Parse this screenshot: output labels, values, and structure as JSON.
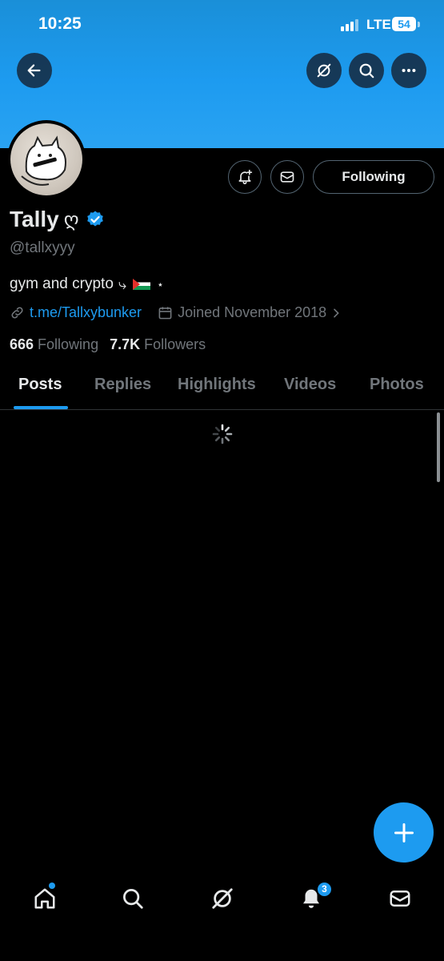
{
  "status_bar": {
    "time": "10:25",
    "network": "LTE",
    "battery": "54"
  },
  "header": {
    "back_icon": "arrow-left-icon",
    "grok_icon": "grok-icon",
    "search_icon": "search-icon",
    "more_icon": "more-horizontal-icon"
  },
  "profile": {
    "display_name": "Tally",
    "name_emoji": "ღ",
    "handle": "@tallxyyy",
    "bio_text": "gym and crypto",
    "bio_arrow": "⤷",
    "bio_sparkle": "⋆",
    "link": "t.me/Tallxybunker",
    "joined": "Joined November 2018",
    "following_count": "666",
    "following_label": "Following",
    "followers_count": "7.7K",
    "followers_label": "Followers"
  },
  "actions": {
    "follow_state": "Following",
    "notify_icon": "bell-plus-icon",
    "message_icon": "envelope-icon"
  },
  "tabs": [
    "Posts",
    "Replies",
    "Highlights",
    "Videos",
    "Photos"
  ],
  "active_tab": "Posts",
  "bottom_nav": {
    "notifications_badge": "3"
  },
  "colors": {
    "accent": "#1d9bf0",
    "background": "#000000",
    "muted": "#71767b",
    "text": "#e7e9ea"
  }
}
